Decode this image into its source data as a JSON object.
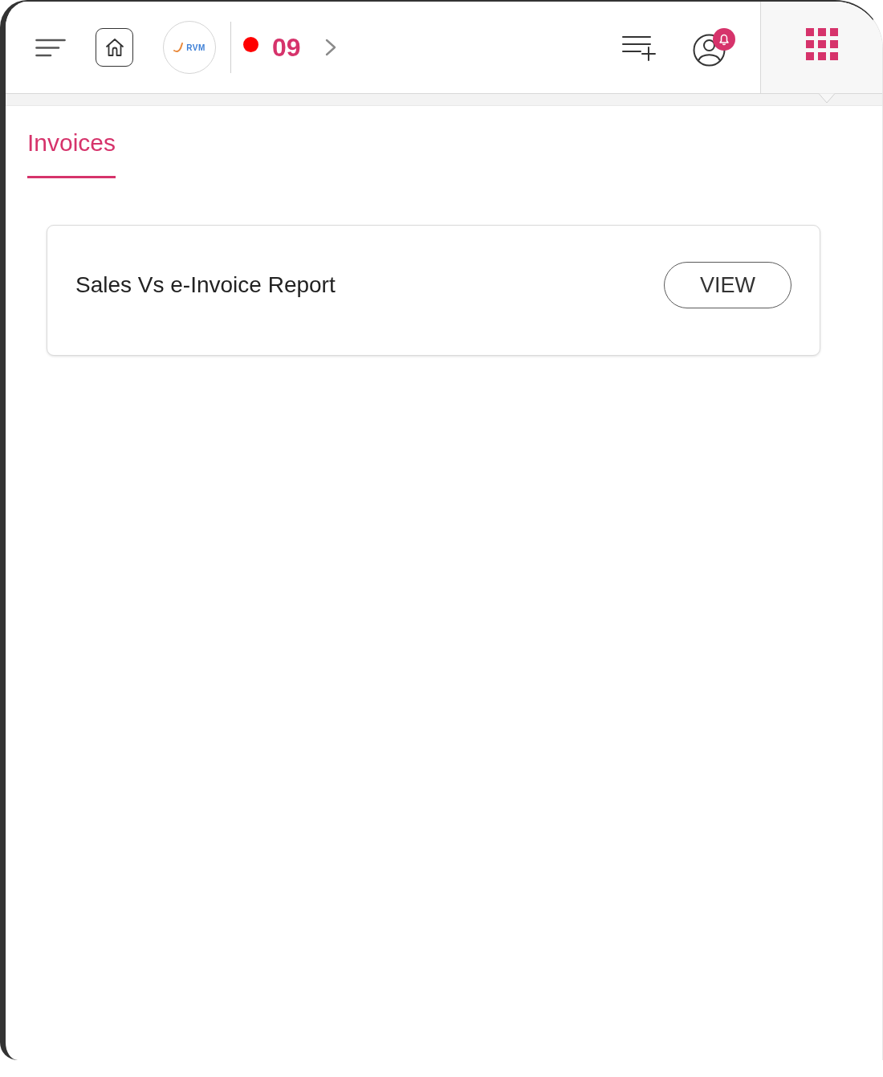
{
  "header": {
    "logo": {
      "text": "RVM"
    },
    "status": {
      "count": "09"
    },
    "notifications": {
      "unread": true
    },
    "apps_menu": {
      "open": true
    }
  },
  "tabs": [
    {
      "label": "Invoices",
      "selected": true
    }
  ],
  "reports": [
    {
      "title": "Sales Vs e-Invoice Report",
      "action": "VIEW"
    }
  ]
}
